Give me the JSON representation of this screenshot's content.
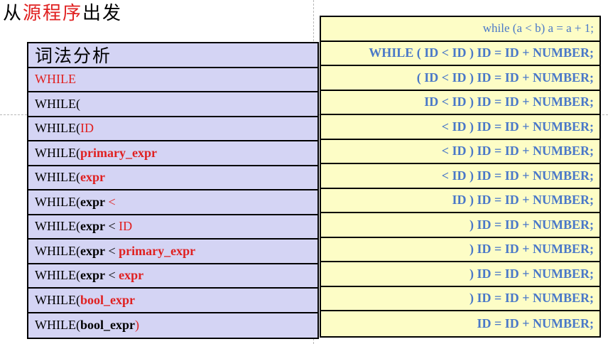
{
  "title": {
    "prefix": "从",
    "highlight": "源程序",
    "suffix": "出发"
  },
  "lexer_header": "词法分析",
  "source_code": "while (a < b) a = a + 1;",
  "token_stream": "WHILE ( ID < ID ) ID = ID + NUMBER;",
  "parse_steps": [
    {
      "stack": [
        {
          "text": "WHILE",
          "style": "red"
        }
      ],
      "remaining": "( ID < ID ) ID = ID + NUMBER;"
    },
    {
      "stack": [
        {
          "text": "WHILE(",
          "style": "normal"
        }
      ],
      "remaining": "ID < ID ) ID = ID + NUMBER;"
    },
    {
      "stack": [
        {
          "text": "WHILE(",
          "style": "normal"
        },
        {
          "text": "ID",
          "style": "red"
        }
      ],
      "remaining": "< ID ) ID = ID + NUMBER;"
    },
    {
      "stack": [
        {
          "text": "WHILE(",
          "style": "normal"
        },
        {
          "text": "primary_expr",
          "style": "red-bold"
        }
      ],
      "remaining": "< ID ) ID = ID + NUMBER;"
    },
    {
      "stack": [
        {
          "text": "WHILE(",
          "style": "normal"
        },
        {
          "text": "expr",
          "style": "red-bold"
        }
      ],
      "remaining": "< ID ) ID = ID + NUMBER;"
    },
    {
      "stack": [
        {
          "text": "WHILE(",
          "style": "normal"
        },
        {
          "text": "expr",
          "style": "bold"
        },
        {
          "text": " <",
          "style": "red"
        }
      ],
      "remaining": "ID ) ID = ID + NUMBER;"
    },
    {
      "stack": [
        {
          "text": "WHILE(",
          "style": "normal"
        },
        {
          "text": "expr",
          "style": "bold"
        },
        {
          "text": " < ",
          "style": "normal"
        },
        {
          "text": "ID",
          "style": "red"
        }
      ],
      "remaining": ") ID = ID + NUMBER;"
    },
    {
      "stack": [
        {
          "text": "WHILE(",
          "style": "normal"
        },
        {
          "text": "expr",
          "style": "bold"
        },
        {
          "text": " < ",
          "style": "normal"
        },
        {
          "text": "primary_expr",
          "style": "red-bold"
        }
      ],
      "remaining": ") ID = ID + NUMBER;"
    },
    {
      "stack": [
        {
          "text": "WHILE(",
          "style": "normal"
        },
        {
          "text": "expr",
          "style": "bold"
        },
        {
          "text": " < ",
          "style": "normal"
        },
        {
          "text": "expr",
          "style": "red-bold"
        }
      ],
      "remaining": ") ID = ID + NUMBER;"
    },
    {
      "stack": [
        {
          "text": "WHILE(",
          "style": "normal"
        },
        {
          "text": "bool_expr",
          "style": "red-bold"
        }
      ],
      "remaining": ") ID = ID + NUMBER;"
    },
    {
      "stack": [
        {
          "text": "WHILE(",
          "style": "normal"
        },
        {
          "text": "bool_expr",
          "style": "bold"
        },
        {
          "text": ")",
          "style": "red"
        }
      ],
      "remaining": "ID = ID + NUMBER;"
    }
  ],
  "colors": {
    "left_bg": "#d4d4f4",
    "right_bg": "#fdfdc6",
    "highlight_red": "#e02020",
    "token_blue": "#4a78c8"
  }
}
